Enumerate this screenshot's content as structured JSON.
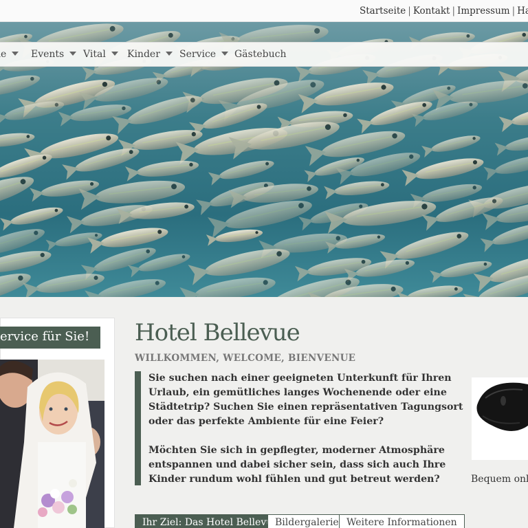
{
  "top_links": {
    "startseite": "Startseite",
    "kontakt": "Kontakt",
    "impressum": "Impressum",
    "haftung": "Haftu",
    "separator": "|"
  },
  "nav": {
    "items": [
      {
        "label": "ne",
        "dropdown": true
      },
      {
        "label": "Events",
        "dropdown": true
      },
      {
        "label": "Vital",
        "dropdown": true
      },
      {
        "label": "Kinder",
        "dropdown": true
      },
      {
        "label": "Service",
        "dropdown": true
      },
      {
        "label": "Gästebuch",
        "dropdown": false
      }
    ]
  },
  "sidebar": {
    "service_label": "ervice für Sie!"
  },
  "main": {
    "title": "Hotel Bellevue",
    "subtitle": "WILLKOMMEN, WELCOME, BIENVENUE",
    "paragraphs": [
      "Sie suchen nach einer geeigneten Unterkunft für Ihren Urlaub, ein gemütliches langes Wochenende oder eine Städtetrip? Suchen Sie einen repräsentativen Tagungsort oder das perfekte Ambiente für eine Feier?",
      "Möchten Sie sich in gepflegter, moderner Atmosphäre entspannen und dabei sicher sein, dass sich auch Ihre Kinder rundum wohl fühlen und gut betreut werden?"
    ],
    "tabs": [
      {
        "label": "Ihr Ziel: Das Hotel Bellevue",
        "active": true
      },
      {
        "label": "Bildergalerie",
        "active": false
      },
      {
        "label": "Weitere Informationen",
        "active": false
      }
    ]
  },
  "promo": {
    "caption": "Bequem onlin"
  },
  "colors": {
    "accent": "#4b5e52",
    "background": "#f0f0ee"
  }
}
